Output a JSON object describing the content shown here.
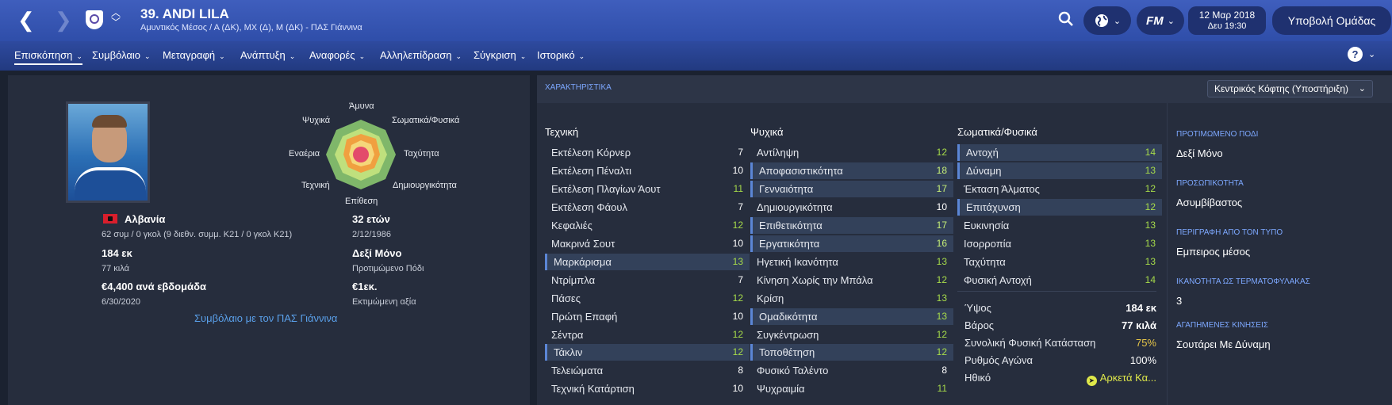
{
  "header": {
    "title": "39. ANDI LILA",
    "subtitle": "Αμυντικός Μέσος / Α (ΔΚ), ΜΧ (Δ), Μ (ΔΚ) - ΠΑΣ Γιάννινα",
    "date": "12 Μαρ 2018",
    "time": "Δευ 19:30",
    "submit_label": "Υποβολή Ομάδας",
    "fm_label": "FM"
  },
  "tabs": [
    {
      "label": "Επισκόπηση"
    },
    {
      "label": "Συμβόλαιο"
    },
    {
      "label": "Μεταγραφή"
    },
    {
      "label": "Ανάπτυξη"
    },
    {
      "label": "Αναφορές"
    },
    {
      "label": "Αλληλεπίδραση"
    },
    {
      "label": "Σύγκριση"
    },
    {
      "label": "Ιστορικό"
    }
  ],
  "overview": {
    "radar_labels": {
      "top": "Άμυνα",
      "top_right": "Σωματικά/Φυσικά",
      "right": "Ταχύτητα",
      "bottom_right": "Δημιουργικότητα",
      "bottom": "Επίθεση",
      "bottom_left": "Τεχνική",
      "left": "Εναέρια",
      "top_left": "Ψυχικά"
    },
    "nationality": "Αλβανία",
    "caps": "62 συμ / 0 γκολ (9 διεθν. συμμ. Κ21 / 0 γκολ Κ21)",
    "age": "32 ετών",
    "dob": "2/12/1986",
    "height": "184 εκ",
    "weight": "77 κιλά",
    "foot": "Δεξί Μόνο",
    "foot_label": "Προτιμώμενο Πόδι",
    "wage": "€4,400 ανά εβδομάδα",
    "contract_end": "6/30/2020",
    "value": "€1εκ.",
    "value_label": "Εκτιμώμενη αξία",
    "contract_link": "Συμβόλαιο με τον ΠΑΣ Γιάννινα"
  },
  "attributes": {
    "section_label": "ΧΑΡΑΚΤΗΡΙΣΤΙΚΑ",
    "role_select": "Κεντρικός Κόφτης (Υποστήριξη)",
    "technical": {
      "title": "Τεχνική",
      "rows": [
        {
          "name": "Εκτέλεση Κόρνερ",
          "value": "7"
        },
        {
          "name": "Εκτέλεση Πέναλτι",
          "value": "10"
        },
        {
          "name": "Εκτέλεση Πλαγίων Άουτ",
          "value": "11"
        },
        {
          "name": "Εκτέλεση Φάουλ",
          "value": "7"
        },
        {
          "name": "Κεφαλιές",
          "value": "12"
        },
        {
          "name": "Μακρινά Σουτ",
          "value": "10"
        },
        {
          "name": "Μαρκάρισμα",
          "value": "13"
        },
        {
          "name": "Ντρίμπλα",
          "value": "7"
        },
        {
          "name": "Πάσες",
          "value": "12"
        },
        {
          "name": "Πρώτη Επαφή",
          "value": "10"
        },
        {
          "name": "Σέντρα",
          "value": "12"
        },
        {
          "name": "Τάκλιν",
          "value": "12"
        },
        {
          "name": "Τελειώματα",
          "value": "8"
        },
        {
          "name": "Τεχνική Κατάρτιση",
          "value": "10"
        }
      ]
    },
    "mental": {
      "title": "Ψυχικά",
      "rows": [
        {
          "name": "Αντίληψη",
          "value": "12"
        },
        {
          "name": "Αποφασιστικότητα",
          "value": "18"
        },
        {
          "name": "Γενναιότητα",
          "value": "17"
        },
        {
          "name": "Δημιουργικότητα",
          "value": "10"
        },
        {
          "name": "Επιθετικότητα",
          "value": "17"
        },
        {
          "name": "Εργατικότητα",
          "value": "16"
        },
        {
          "name": "Ηγετική Ικανότητα",
          "value": "13"
        },
        {
          "name": "Κίνηση Χωρίς την Μπάλα",
          "value": "12"
        },
        {
          "name": "Κρίση",
          "value": "13"
        },
        {
          "name": "Ομαδικότητα",
          "value": "13"
        },
        {
          "name": "Συγκέντρωση",
          "value": "12"
        },
        {
          "name": "Τοποθέτηση",
          "value": "12"
        },
        {
          "name": "Φυσικό Ταλέντο",
          "value": "8"
        },
        {
          "name": "Ψυχραιμία",
          "value": "11"
        }
      ]
    },
    "physical": {
      "title": "Σωματικά/Φυσικά",
      "rows": [
        {
          "name": "Αντοχή",
          "value": "14"
        },
        {
          "name": "Δύναμη",
          "value": "13"
        },
        {
          "name": "Έκταση Άλματος",
          "value": "12"
        },
        {
          "name": "Επιτάχυνση",
          "value": "12"
        },
        {
          "name": "Ευκινησία",
          "value": "13"
        },
        {
          "name": "Ισορροπία",
          "value": "13"
        },
        {
          "name": "Ταχύτητα",
          "value": "13"
        },
        {
          "name": "Φυσική Αντοχή",
          "value": "14"
        }
      ]
    },
    "meta": [
      {
        "name": "Ύψος",
        "value": "184 εκ"
      },
      {
        "name": "Βάρος",
        "value": "77 κιλά"
      },
      {
        "name": "Συνολική Φυσική Κατάσταση",
        "value": "75%"
      },
      {
        "name": "Ρυθμός Αγώνα",
        "value": "100%"
      },
      {
        "name": "Ηθικό",
        "value": "Αρκετά Κα..."
      }
    ],
    "side": [
      {
        "label": "ΠΡΟΤΙΜΩΜΕΝΟ ΠΟΔΙ",
        "value": "Δεξί Μόνο"
      },
      {
        "label": "ΠΡΟΣΩΠΙΚΟΤΗΤΑ",
        "value": "Ασυμβίβαστος"
      },
      {
        "label": "ΠΕΡΙΓΡΑΦΗ ΑΠΟ ΤΟΝ ΤΥΠΟ",
        "value": "Εμπειρος μέσος"
      },
      {
        "label": "ΙΚΑΝΟΤΗΤΑ ΩΣ ΤΕΡΜΑΤΟΦΥΛΑΚΑΣ",
        "value": "3"
      },
      {
        "label": "ΑΓΑΠΗΜΕΝΕΣ ΚΙΝΗΣΕΙΣ",
        "value": "Σουτάρει Με Δύναμη"
      }
    ]
  }
}
